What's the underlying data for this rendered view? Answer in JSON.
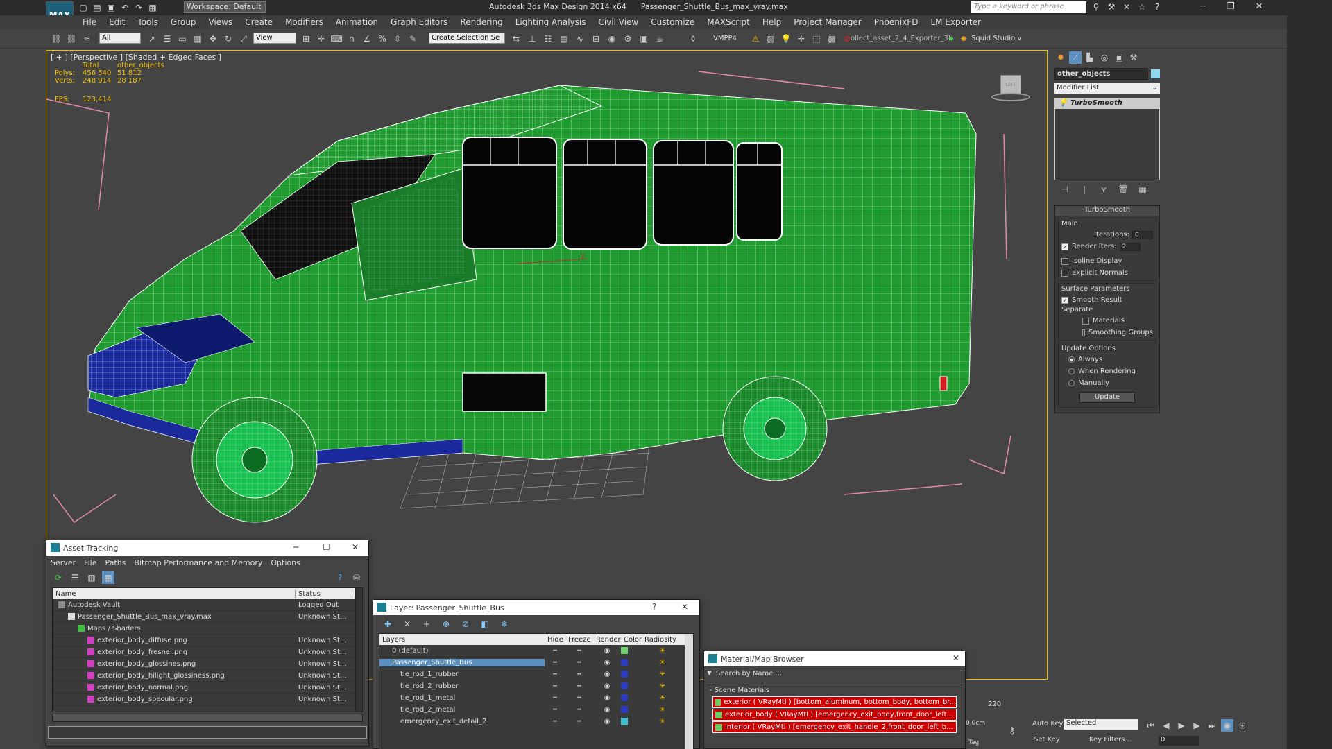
{
  "app": {
    "title": "Autodesk 3ds Max Design 2014 x64",
    "file": "Passenger_Shuttle_Bus_max_vray.max",
    "workspace": "Workspace: Default",
    "search_placeholder": "Type a keyword or phrase",
    "logo": "MAX"
  },
  "menu": [
    "File",
    "Edit",
    "Tools",
    "Group",
    "Views",
    "Create",
    "Modifiers",
    "Animation",
    "Graph Editors",
    "Rendering",
    "Lighting Analysis",
    "Civil View",
    "Customize",
    "MAXScript",
    "Help",
    "Project Manager",
    "PhoenixFD",
    "LM Exporter"
  ],
  "toolbar": {
    "filter": "All",
    "ref_coord": "View",
    "selection_set": "Create Selection Se",
    "vmpp": "VMPP4",
    "exporter": "ollect_asset_2_4_Exporter_3I",
    "squid": "Squid Studio v"
  },
  "viewport": {
    "label": "[ + ] [Perspective ] [Shaded + Edged Faces ]",
    "stats": {
      "col_total": "Total",
      "col_obj": "other_objects",
      "polys_label": "Polys:",
      "polys_total": "456 540",
      "polys_obj": "51 812",
      "verts_label": "Verts:",
      "verts_total": "248 914",
      "verts_obj": "28 187",
      "fps_label": "FPS:",
      "fps": "123,414"
    },
    "viewcube": "LEFT"
  },
  "command_panel": {
    "object_name": "other_objects",
    "modifier_list": "Modifier List",
    "stack_item": "TurboSmooth",
    "rollout_title": "TurboSmooth",
    "main_label": "Main",
    "iterations_label": "Iterations:",
    "iterations": "0",
    "render_iters_label": "Render Iters:",
    "render_iters": "2",
    "isoline": "Isoline Display",
    "explicit": "Explicit Normals",
    "surface_params": "Surface Parameters",
    "smooth_result": "Smooth Result",
    "separate": "Separate",
    "materials": "Materials",
    "smoothing_groups": "Smoothing Groups",
    "update_options": "Update Options",
    "always": "Always",
    "when_rendering": "When Rendering",
    "manually": "Manually",
    "update_btn": "Update"
  },
  "asset_tracking": {
    "title": "Asset Tracking",
    "menu": [
      "Server",
      "File",
      "Paths",
      "Bitmap Performance and Memory",
      "Options"
    ],
    "col_name": "Name",
    "col_status": "Status",
    "col_p": "P",
    "rows": [
      {
        "name": "Autodesk Vault",
        "status": "Logged Out",
        "indent": 0
      },
      {
        "name": "Passenger_Shuttle_Bus_max_vray.max",
        "status": "Unknown St...",
        "indent": 1
      },
      {
        "name": "Maps / Shaders",
        "status": "",
        "indent": 2
      },
      {
        "name": "exterior_body_diffuse.png",
        "status": "Unknown St...",
        "indent": 3
      },
      {
        "name": "exterior_body_fresnel.png",
        "status": "Unknown St...",
        "indent": 3
      },
      {
        "name": "exterior_body_glossines.png",
        "status": "Unknown St...",
        "indent": 3
      },
      {
        "name": "exterior_body_hilight_glossiness.png",
        "status": "Unknown St...",
        "indent": 3
      },
      {
        "name": "exterior_body_normal.png",
        "status": "Unknown St...",
        "indent": 3
      },
      {
        "name": "exterior_body_specular.png",
        "status": "Unknown St...",
        "indent": 3
      }
    ]
  },
  "layer_dialog": {
    "title": "Layer: Passenger_Shuttle_Bus",
    "help": "?",
    "cols": [
      "Layers",
      "Hide",
      "Freeze",
      "Render",
      "Color",
      "Radiosity"
    ],
    "rows": [
      {
        "name": "0 (default)",
        "color": "#6fd06f"
      },
      {
        "name": "Passenger_Shuttle_Bus",
        "color": "#2c3cc0"
      },
      {
        "name": "tie_rod_1_rubber",
        "color": "#2c3cc0"
      },
      {
        "name": "tie_rod_2_rubber",
        "color": "#2c3cc0"
      },
      {
        "name": "tie_rod_1_metal",
        "color": "#2c3cc0"
      },
      {
        "name": "tie_rod_2_metal",
        "color": "#2c3cc0"
      },
      {
        "name": "emergency_exit_detail_2",
        "color": "#3ac0d0"
      }
    ]
  },
  "material_browser": {
    "title": "Material/Map Browser",
    "search": "Search by Name ...",
    "section": "- Scene Materials",
    "items": [
      "exterior  ( VRayMtl )  [bottom_aluminum, bottom_body, bottom_br...",
      "exterior_body  ( VRayMtl )  [emergency_exit_body,front_door_left...",
      "interior  ( VRayMtl )  [emergency_exit_handle_2,front_door_left_b..."
    ]
  },
  "status": {
    "frame": "220",
    "coord": "0,0cm",
    "auto_key": "Auto Key",
    "selected": "Selected",
    "set_key": "Set Key",
    "key_filters": "Key Filters...",
    "frame_num": "0",
    "tag": "Tag"
  }
}
